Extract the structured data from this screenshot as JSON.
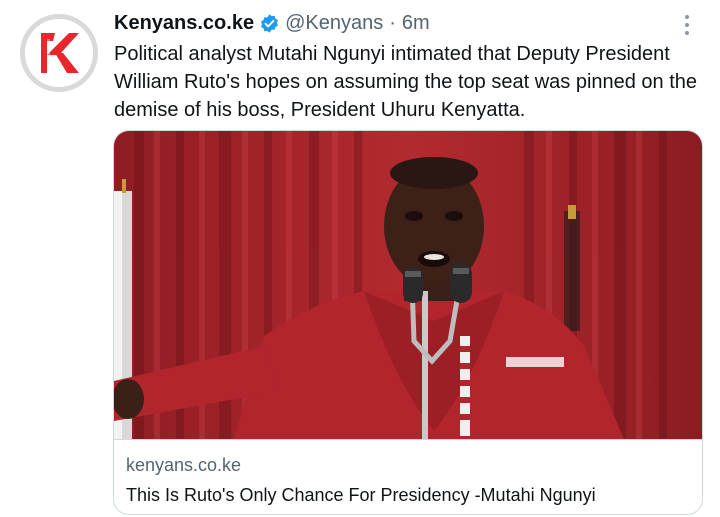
{
  "author": {
    "display_name": "Kenyans.co.ke",
    "handle": "@Kenyans",
    "separator": "·",
    "time": "6m",
    "verified": true,
    "avatar_icon": "kenyans-k-logo",
    "avatar_letter": "K"
  },
  "tweet": {
    "text": "Political analyst Mutahi Ngunyi intimated that Deputy President William Ruto's hopes on assuming the top seat was pinned on the demise of his boss, President Uhuru Kenyatta."
  },
  "card": {
    "image_icon": "man-speaking-at-microphones-photo",
    "domain": "kenyans.co.ke",
    "title": "This Is Ruto's Only Chance For Presidency -Mutahi Ngunyi"
  },
  "menu": {
    "icon": "more-vertical-icon"
  },
  "colors": {
    "verified_blue": "#1d9bf0",
    "secondary_text": "#536471",
    "brand_red": "#e8262b",
    "curtain_red": "#a8242a"
  }
}
